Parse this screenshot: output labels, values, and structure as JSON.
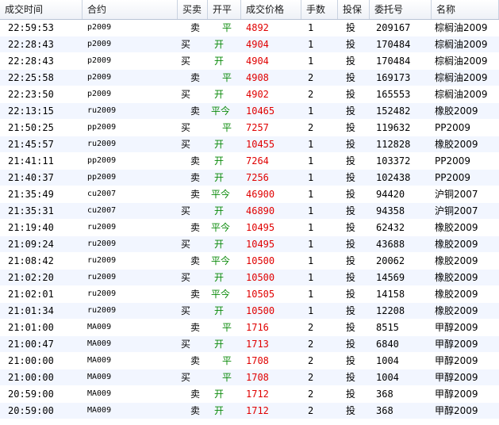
{
  "headers": [
    "成交时间",
    "合约",
    "买卖",
    "开平",
    "成交价格",
    "手数",
    "投保",
    "委托号",
    "名称"
  ],
  "rows": [
    {
      "time": "22:59:53",
      "contract": "p2009",
      "dir": "卖",
      "oc": "平",
      "price": "4892",
      "qty": "1",
      "hedge": "投",
      "order": "209167",
      "name": "棕榈油2009"
    },
    {
      "time": "22:28:43",
      "contract": "p2009",
      "dir": "买",
      "oc": "开",
      "price": "4904",
      "qty": "1",
      "hedge": "投",
      "order": "170484",
      "name": "棕榈油2009"
    },
    {
      "time": "22:28:43",
      "contract": "p2009",
      "dir": "买",
      "oc": "开",
      "price": "4904",
      "qty": "1",
      "hedge": "投",
      "order": "170484",
      "name": "棕榈油2009"
    },
    {
      "time": "22:25:58",
      "contract": "p2009",
      "dir": "卖",
      "oc": "平",
      "price": "4908",
      "qty": "2",
      "hedge": "投",
      "order": "169173",
      "name": "棕榈油2009"
    },
    {
      "time": "22:23:50",
      "contract": "p2009",
      "dir": "买",
      "oc": "开",
      "price": "4902",
      "qty": "2",
      "hedge": "投",
      "order": "165553",
      "name": "棕榈油2009"
    },
    {
      "time": "22:13:15",
      "contract": "ru2009",
      "dir": "卖",
      "oc": "平今",
      "price": "10465",
      "qty": "1",
      "hedge": "投",
      "order": "152482",
      "name": "橡胶2009"
    },
    {
      "time": "21:50:25",
      "contract": "pp2009",
      "dir": "买",
      "oc": "平",
      "price": "7257",
      "qty": "2",
      "hedge": "投",
      "order": "119632",
      "name": "PP2009"
    },
    {
      "time": "21:45:57",
      "contract": "ru2009",
      "dir": "买",
      "oc": "开",
      "price": "10455",
      "qty": "1",
      "hedge": "投",
      "order": "112828",
      "name": "橡胶2009"
    },
    {
      "time": "21:41:11",
      "contract": "pp2009",
      "dir": "卖",
      "oc": "开",
      "price": "7264",
      "qty": "1",
      "hedge": "投",
      "order": "103372",
      "name": "PP2009"
    },
    {
      "time": "21:40:37",
      "contract": "pp2009",
      "dir": "卖",
      "oc": "开",
      "price": "7256",
      "qty": "1",
      "hedge": "投",
      "order": "102438",
      "name": "PP2009"
    },
    {
      "time": "21:35:49",
      "contract": "cu2007",
      "dir": "卖",
      "oc": "平今",
      "price": "46900",
      "qty": "1",
      "hedge": "投",
      "order": "94420",
      "name": "沪铜2007"
    },
    {
      "time": "21:35:31",
      "contract": "cu2007",
      "dir": "买",
      "oc": "开",
      "price": "46890",
      "qty": "1",
      "hedge": "投",
      "order": "94358",
      "name": "沪铜2007"
    },
    {
      "time": "21:19:40",
      "contract": "ru2009",
      "dir": "卖",
      "oc": "平今",
      "price": "10495",
      "qty": "1",
      "hedge": "投",
      "order": "62432",
      "name": "橡胶2009"
    },
    {
      "time": "21:09:24",
      "contract": "ru2009",
      "dir": "买",
      "oc": "开",
      "price": "10495",
      "qty": "1",
      "hedge": "投",
      "order": "43688",
      "name": "橡胶2009"
    },
    {
      "time": "21:08:42",
      "contract": "ru2009",
      "dir": "卖",
      "oc": "平今",
      "price": "10500",
      "qty": "1",
      "hedge": "投",
      "order": "20062",
      "name": "橡胶2009"
    },
    {
      "time": "21:02:20",
      "contract": "ru2009",
      "dir": "买",
      "oc": "开",
      "price": "10500",
      "qty": "1",
      "hedge": "投",
      "order": "14569",
      "name": "橡胶2009"
    },
    {
      "time": "21:02:01",
      "contract": "ru2009",
      "dir": "卖",
      "oc": "平今",
      "price": "10505",
      "qty": "1",
      "hedge": "投",
      "order": "14158",
      "name": "橡胶2009"
    },
    {
      "time": "21:01:34",
      "contract": "ru2009",
      "dir": "买",
      "oc": "开",
      "price": "10500",
      "qty": "1",
      "hedge": "投",
      "order": "12208",
      "name": "橡胶2009"
    },
    {
      "time": "21:01:00",
      "contract": "MA009",
      "dir": "卖",
      "oc": "平",
      "price": "1716",
      "qty": "2",
      "hedge": "投",
      "order": "8515",
      "name": "甲醇2009"
    },
    {
      "time": "21:00:47",
      "contract": "MA009",
      "dir": "买",
      "oc": "开",
      "price": "1713",
      "qty": "2",
      "hedge": "投",
      "order": "6840",
      "name": "甲醇2009"
    },
    {
      "time": "21:00:00",
      "contract": "MA009",
      "dir": "卖",
      "oc": "平",
      "price": "1708",
      "qty": "2",
      "hedge": "投",
      "order": "1004",
      "name": "甲醇2009"
    },
    {
      "time": "21:00:00",
      "contract": "MA009",
      "dir": "买",
      "oc": "平",
      "price": "1708",
      "qty": "2",
      "hedge": "投",
      "order": "1004",
      "name": "甲醇2009"
    },
    {
      "time": "20:59:00",
      "contract": "MA009",
      "dir": "卖",
      "oc": "开",
      "price": "1712",
      "qty": "2",
      "hedge": "投",
      "order": "368",
      "name": "甲醇2009"
    },
    {
      "time": "20:59:00",
      "contract": "MA009",
      "dir": "卖",
      "oc": "开",
      "price": "1712",
      "qty": "2",
      "hedge": "投",
      "order": "368",
      "name": "甲醇2009"
    }
  ]
}
